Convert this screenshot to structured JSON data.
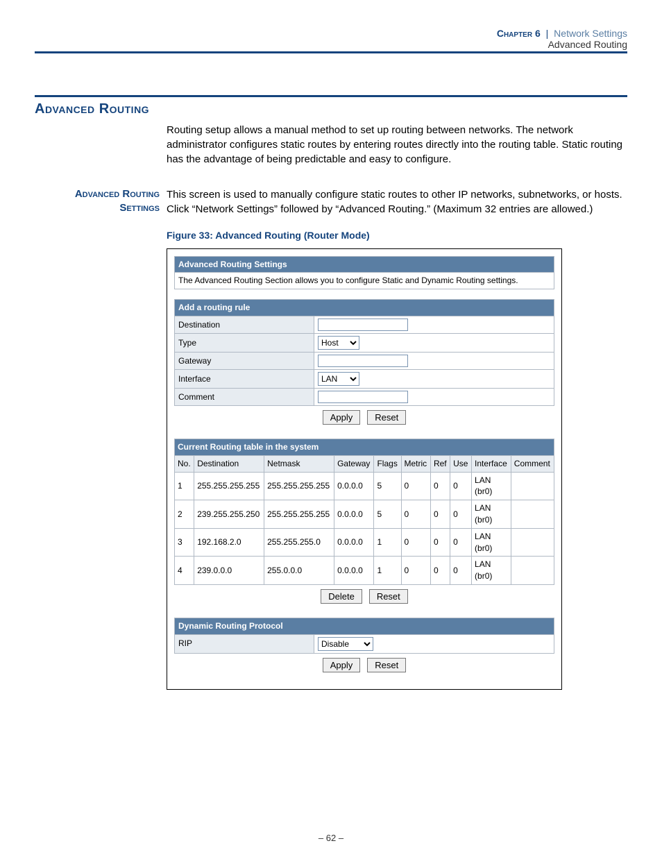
{
  "header": {
    "chapter": "Chapter 6",
    "separator": "|",
    "section": "Network Settings",
    "subsection": "Advanced Routing"
  },
  "section_title": "Advanced Routing",
  "intro_para": "Routing setup allows a manual method to set up routing between networks. The network administrator configures static routes by entering routes directly into the routing table. Static routing has the advantage of being predictable and easy to configure.",
  "side_label_line1": "Advanced Routing",
  "side_label_line2": "Settings",
  "settings_para": "This screen is used to manually configure static routes to other IP networks, subnetworks, or hosts. Click “Network Settings” followed by “Advanced Routing.” (Maximum 32 entries are allowed.)",
  "figure_caption": "Figure 33:  Advanced Routing (Router Mode)",
  "screenshot": {
    "ars_header": "Advanced Routing Settings",
    "ars_desc": "The Advanced Routing Section allows you to configure Static and Dynamic Routing settings.",
    "add_rule_header": "Add a routing rule",
    "fields": {
      "destination": "Destination",
      "type": "Type",
      "gateway": "Gateway",
      "interface": "Interface",
      "comment": "Comment"
    },
    "type_value": "Host",
    "interface_value": "LAN",
    "dest_value": "",
    "gateway_value": "",
    "comment_value": "",
    "apply": "Apply",
    "reset": "Reset",
    "delete": "Delete",
    "rt_header": "Current Routing table in the system",
    "rt_columns": [
      "No.",
      "Destination",
      "Netmask",
      "Gateway",
      "Flags",
      "Metric",
      "Ref",
      "Use",
      "Interface",
      "Comment"
    ],
    "rt_rows": [
      [
        "1",
        "255.255.255.255",
        "255.255.255.255",
        "0.0.0.0",
        "5",
        "0",
        "0",
        "0",
        "LAN (br0)",
        ""
      ],
      [
        "2",
        "239.255.255.250",
        "255.255.255.255",
        "0.0.0.0",
        "5",
        "0",
        "0",
        "0",
        "LAN (br0)",
        ""
      ],
      [
        "3",
        "192.168.2.0",
        "255.255.255.0",
        "0.0.0.0",
        "1",
        "0",
        "0",
        "0",
        "LAN (br0)",
        ""
      ],
      [
        "4",
        "239.0.0.0",
        "255.0.0.0",
        "0.0.0.0",
        "1",
        "0",
        "0",
        "0",
        "LAN (br0)",
        ""
      ]
    ],
    "drp_header": "Dynamic Routing Protocol",
    "rip_label": "RIP",
    "rip_value": "Disable"
  },
  "page_number": "–  62  –"
}
